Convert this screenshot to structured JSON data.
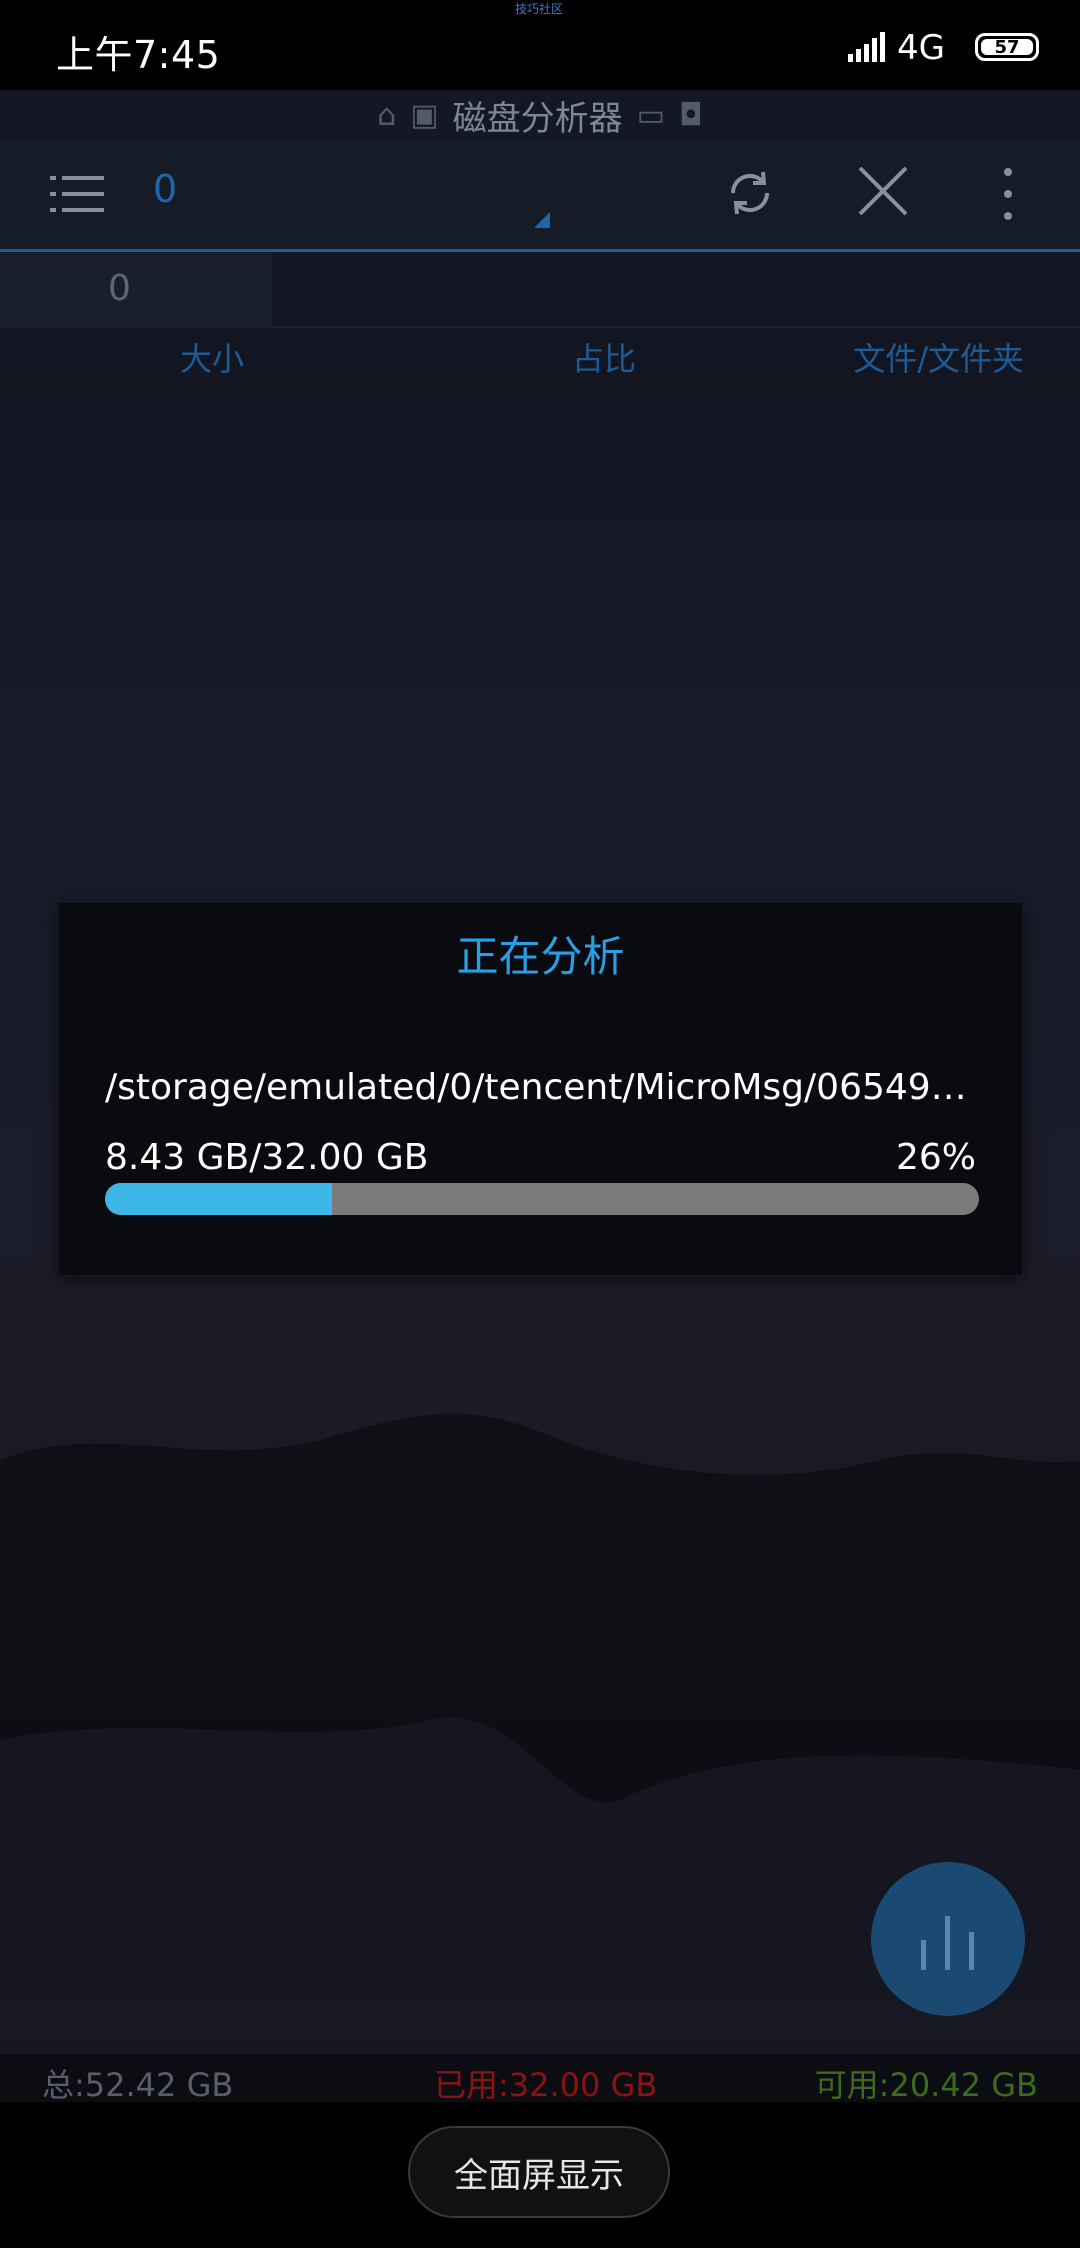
{
  "status_bar": {
    "time": "上午7:45",
    "top_tag": "技巧社区",
    "network": "4G",
    "battery": "57"
  },
  "app": {
    "title": "磁盘分析器",
    "path_value": "0",
    "breadcrumb": "0",
    "columns": {
      "size": "大小",
      "ratio": "占比",
      "files": "文件/文件夹"
    }
  },
  "dialog": {
    "title": "正在分析",
    "path": "/storage/emulated/0/tencent/MicroMsg/06549…",
    "size_text": "8.43 GB/32.00 GB",
    "percent_text": "26%",
    "progress_fraction": 0.26
  },
  "storage": {
    "total": "总:52.42 GB",
    "used": "已用:32.00 GB",
    "free": "可用:20.42 GB"
  },
  "bottom": {
    "fullscreen_label": "全面屏显示"
  },
  "colors": {
    "accent": "#2a9fe4",
    "progress": "#3bb6e6",
    "used": "#8a1414",
    "free": "#3c6a1e"
  }
}
